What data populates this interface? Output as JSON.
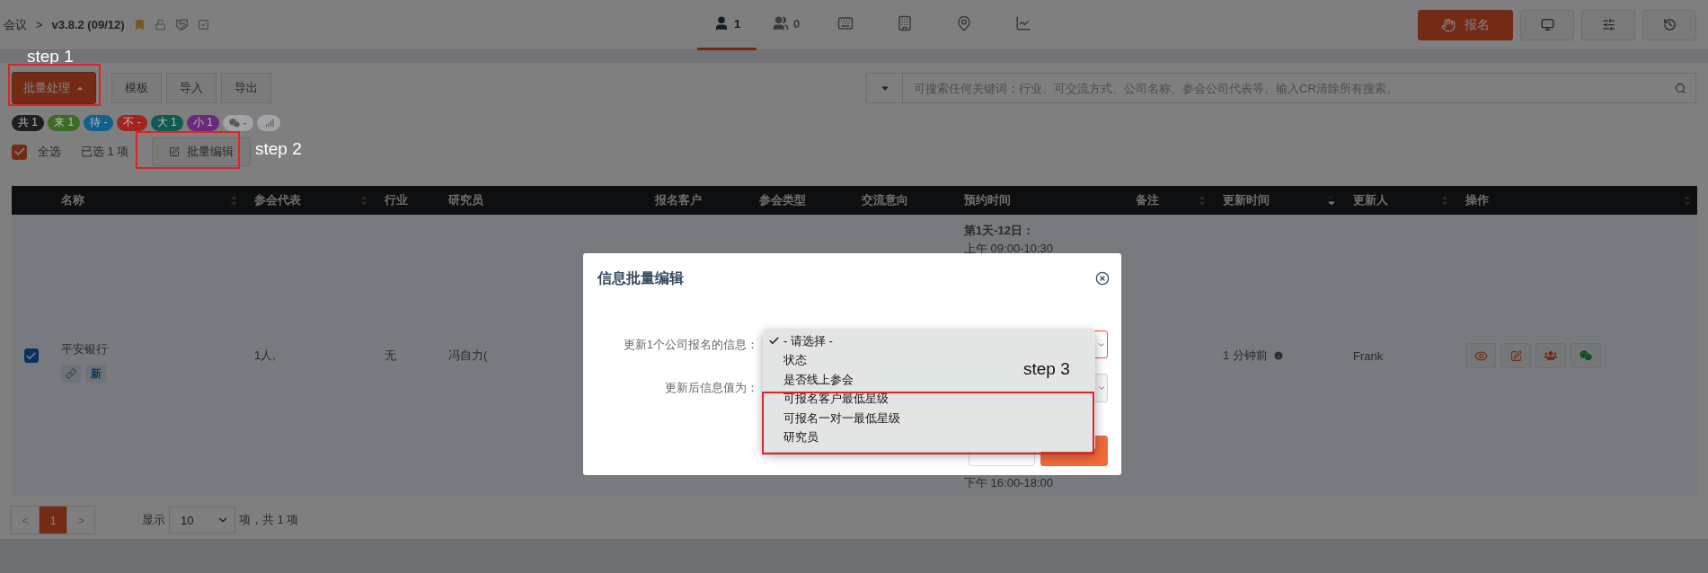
{
  "breadcrumb": {
    "parent": "会议",
    "separator": ">",
    "version": "v3.8.2 (09/12)"
  },
  "nav_tabs": [
    {
      "count": "1",
      "selected": true
    },
    {
      "count": "0",
      "selected": false
    },
    {
      "selected": false
    },
    {
      "selected": false
    },
    {
      "selected": false
    },
    {
      "selected": false
    }
  ],
  "header_buttons": [
    {
      "kind": "primary",
      "label": "报名"
    },
    {
      "kind": "monitor"
    },
    {
      "kind": "sliders"
    },
    {
      "kind": "history"
    }
  ],
  "toolbar": {
    "batch_button": "批量处理",
    "group_buttons": [
      "模板",
      "导入",
      "导出"
    ],
    "search_placeholder": "可搜索任何关键词：行业、可交流方式、公司名称、参会公司代表等。输入CR清除所有搜索。"
  },
  "tags": [
    {
      "kind": "text",
      "label": "共",
      "value": "1",
      "color": "#1c1e21"
    },
    {
      "kind": "text",
      "label": "来",
      "value": "1",
      "color": "#3d6a26"
    },
    {
      "kind": "text",
      "label": "待",
      "value": "-",
      "color": "#11618f"
    },
    {
      "kind": "text",
      "label": "不",
      "value": "-",
      "color": "#a3241e"
    },
    {
      "kind": "text",
      "label": "大",
      "value": "1",
      "color": "#0e5c4f"
    },
    {
      "kind": "text",
      "label": "小",
      "value": "1",
      "color": "#682a7c"
    },
    {
      "kind": "wechat",
      "value": "-",
      "color": "#a2a4a7"
    },
    {
      "kind": "signal",
      "color": "#a2a4a7"
    }
  ],
  "selection": {
    "select_all": "全选",
    "checked": true,
    "count_text": "已选 1 项",
    "edit_button": "批量编辑"
  },
  "table": {
    "columns": [
      {
        "label": "名称",
        "sortable": true,
        "descending": false
      },
      {
        "label": "参会代表",
        "sortable": true,
        "descending": false
      },
      {
        "label": "行业",
        "sortable": false,
        "descending": false
      },
      {
        "label": "研究员",
        "sortable": false,
        "descending": false
      },
      {
        "label": "报名客户",
        "sortable": false,
        "descending": false
      },
      {
        "label": "参会类型",
        "sortable": false,
        "descending": false
      },
      {
        "label": "交流意向",
        "sortable": false,
        "descending": false
      },
      {
        "label": "预约时间",
        "sortable": false,
        "descending": false
      },
      {
        "label": "备注",
        "sortable": true,
        "descending": false
      },
      {
        "label": "更新时间",
        "sortable": true,
        "descending": true
      },
      {
        "label": "更新人",
        "sortable": true,
        "descending": false
      },
      {
        "label": "操作",
        "sortable": true,
        "descending": false
      }
    ],
    "rows": [
      {
        "checked": true,
        "name": "平安银行",
        "badge": "新",
        "representative": "1人,",
        "industry": "无",
        "researcher": "冯自力(",
        "time_day": "第1天-12日：",
        "time_first": "上午 09:00-10:30",
        "time_last": "下午 16:00-18:00",
        "updated": "1 分钟前",
        "updater": "Frank"
      }
    ]
  },
  "pagination": {
    "prev": "<",
    "pages": [
      {
        "label": "1",
        "selected": true
      }
    ],
    "next": ">",
    "show": "显示",
    "page_size": "10",
    "summary": "项，共 1 项"
  },
  "dialog": {
    "title": "信息批量编辑",
    "fields": [
      {
        "label": "更新1个公司报名的信息：",
        "focused": true
      },
      {
        "label": "更新后信息值为：",
        "focused": false
      }
    ],
    "options": [
      {
        "label": "- 请选择 -",
        "selected": true
      },
      {
        "label": "状态",
        "selected": false
      },
      {
        "label": "是否线上参会",
        "selected": false
      },
      {
        "label": "可报名客户最低星级",
        "selected": false
      },
      {
        "label": "可报名一对一最低星级",
        "selected": false
      },
      {
        "label": "研究员",
        "selected": false
      }
    ]
  },
  "annotations": [
    "step 1",
    "step 2",
    "step 3"
  ]
}
